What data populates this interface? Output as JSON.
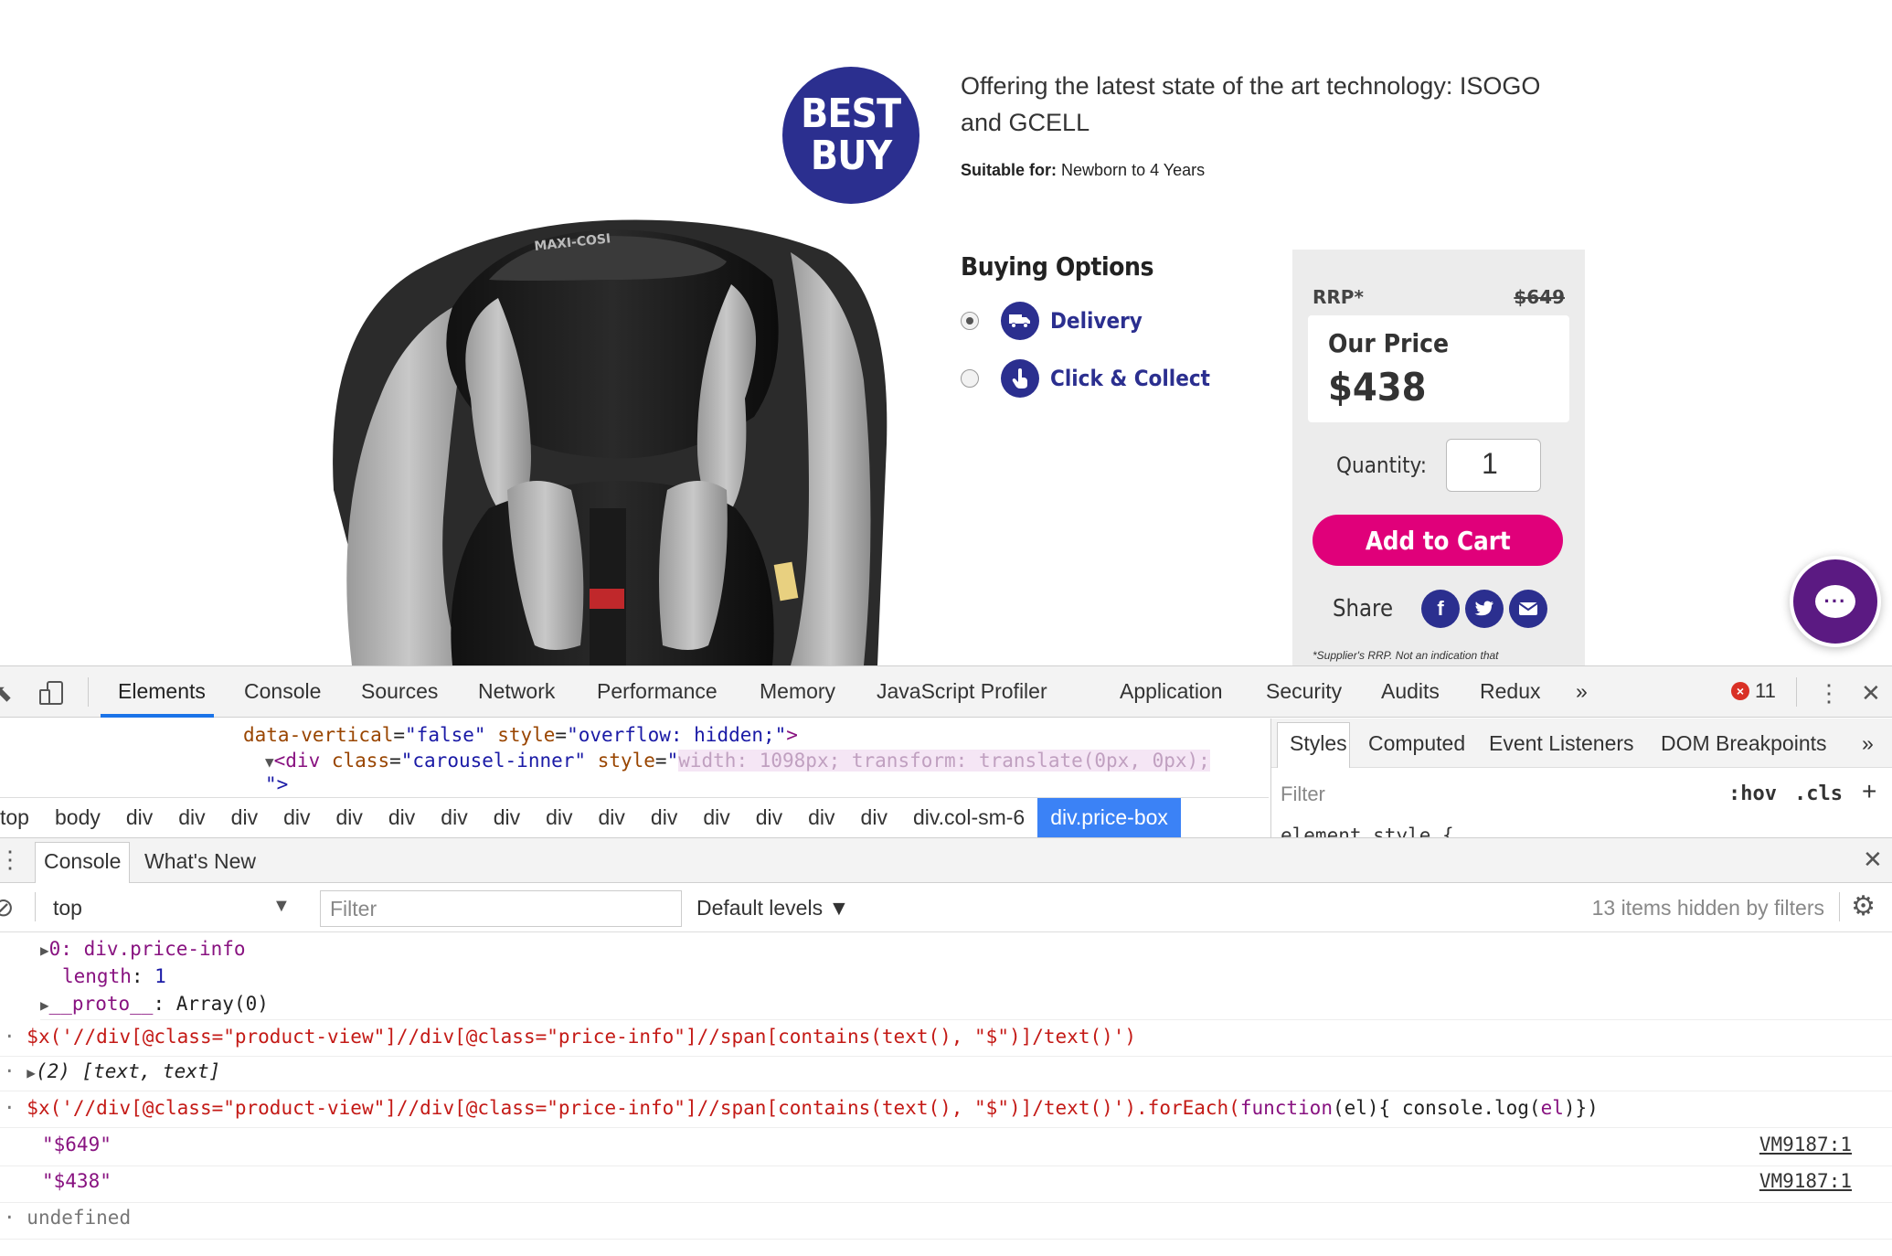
{
  "product": {
    "logo_line1": "BEST",
    "logo_line2": "BUY",
    "tagline": "Offering the latest state of the art technology: ISOGO and GCELL",
    "suitable_label": "Suitable for:",
    "suitable_value": "Newborn to 4 Years",
    "seat_brand": "MAXI-COSI"
  },
  "buying": {
    "title": "Buying Options",
    "options": [
      {
        "label": "Delivery",
        "selected": true,
        "icon": "truck-icon"
      },
      {
        "label": "Click & Collect",
        "selected": false,
        "icon": "hand-tap-icon"
      }
    ]
  },
  "price_box": {
    "rrp_label": "RRP*",
    "rrp_value": "$649",
    "our_price_label": "Our Price",
    "our_price_value": "$438",
    "quantity_label": "Quantity:",
    "quantity_value": "1",
    "add_to_cart": "Add to Cart",
    "share_label": "Share",
    "disclaimer": "*Supplier's RRP. Not an indication that"
  },
  "colors": {
    "brand_blue": "#2b2f8f",
    "cart_pink": "#e0007a",
    "chat_purple": "#5b1a82",
    "devtools_active": "#1a73e8"
  },
  "devtools": {
    "tabs": [
      "Elements",
      "Console",
      "Sources",
      "Network",
      "Performance",
      "Memory",
      "JavaScript Profiler",
      "Application",
      "Security",
      "Audits",
      "Redux"
    ],
    "active_tab": "Elements",
    "more": "»",
    "error_count": "11",
    "elements_code": {
      "line1_attr1": "data-vertical",
      "line1_val1": "\"false\"",
      "line1_attr2": "style",
      "line1_val2": "\"overflow: hidden;\"",
      "line1_end": ">",
      "line2_tag": "<div",
      "line2_attr1": "class",
      "line2_val1": "\"carousel-inner\"",
      "line2_attr2": "style",
      "line2_val2": "width: 1098px; transform: translate(0px, 0px);",
      "line3": "\">"
    },
    "breadcrumb": [
      "top",
      "body",
      "div",
      "div",
      "div",
      "div",
      "div",
      "div",
      "div",
      "div",
      "div",
      "div",
      "div",
      "div",
      "div",
      "div",
      "div",
      "div.col-sm-6",
      "div.price-box"
    ],
    "styles_tabs": [
      "Styles",
      "Computed",
      "Event Listeners",
      "DOM Breakpoints"
    ],
    "styles_filter": "Filter",
    "styles_hov": ":hov",
    "styles_cls": ".cls",
    "styles_element_style": "element.style {",
    "drawer_tabs": [
      "Console",
      "What's New"
    ],
    "console_context": "top",
    "console_filter_placeholder": "Filter",
    "console_levels": "Default levels ▼",
    "hidden_by_filters": "13 items hidden by filters",
    "log": {
      "row1": "0: div.price-info",
      "row2_key": "length",
      "row2_val": "1",
      "row3_key": "__proto__",
      "row3_val": ": Array(0)",
      "cmd1": "$x('//div[@class=\"product-view\"]//div[@class=\"price-info\"]//span[contains(text(), \"$\")]/text()')",
      "result1": "(2) [text, text]",
      "cmd2_main": "$x('//div[@class=\"product-view\"]//div[@class=\"price-info\"]//span[contains(text(), \"$\")]/text()').forEach(",
      "cmd2_fn": "function",
      "cmd2_args": "(el){ console.log(",
      "cmd2_el": "el",
      "cmd2_end": ")})",
      "out1": "\"$649\"",
      "out2": "\"$438\"",
      "src1": "VM9187:1",
      "src2": "VM9187:1",
      "final": "undefined"
    }
  }
}
